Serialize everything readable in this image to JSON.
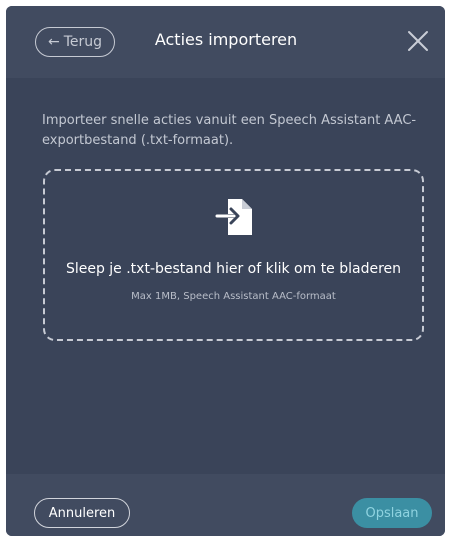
{
  "header": {
    "back_label": "Terug",
    "title": "Acties importeren",
    "close_icon": "close-icon"
  },
  "main": {
    "description": "Importeer snelle acties vanuit een Speech Assistant AAC-exportbestand (.txt-formaat).",
    "dropzone": {
      "icon": "file-import-icon",
      "label": "Sleep je .txt-bestand hier of klik om te bladeren",
      "hint": "Max 1MB, Speech Assistant AAC-formaat"
    }
  },
  "footer": {
    "cancel_label": "Annuleren",
    "save_label": "Opslaan"
  },
  "colors": {
    "dialog_bg": "#3a4459",
    "header_bg": "#414b60",
    "accent": "#3b8fa3"
  }
}
